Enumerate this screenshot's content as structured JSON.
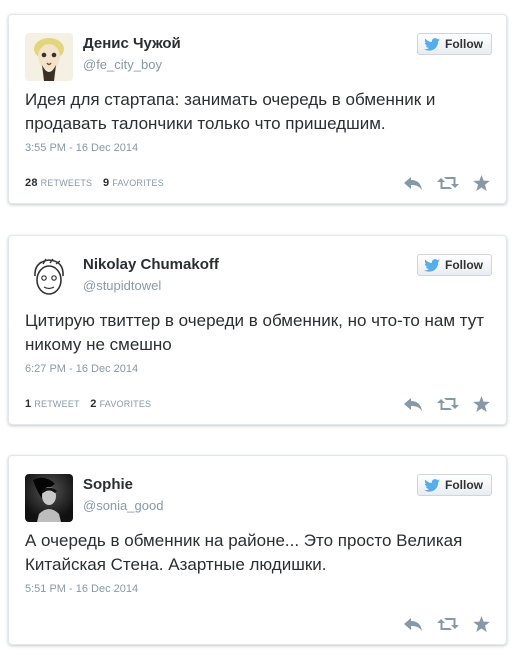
{
  "colors": {
    "twitter_blue": "#55acee",
    "muted": "#8899a6",
    "action_icon": "#8899a6"
  },
  "follow_label": "Follow",
  "tweets": [
    {
      "name": "Денис Чужой",
      "handle": "@fe_city_boy",
      "text": "Идея для стартапа: занимать очередь в обменник и продавать талончики только что пришедшим.",
      "time": "3:55 PM - 16 Dec 2014",
      "retweets_count": "28",
      "retweets_label": "RETWEETS",
      "favorites_count": "9",
      "favorites_label": "FAVORITES",
      "avatar_icon": "cartoon-face-avatar"
    },
    {
      "name": "Nikolay Chumakoff",
      "handle": "@stupidtowel",
      "text": "Цитирую твиттер в очереди в обменник, но что-то нам тут никому не смешно",
      "time": "6:27 PM - 16 Dec 2014",
      "retweets_count": "1",
      "retweets_label": "RETWEET",
      "favorites_count": "2",
      "favorites_label": "FAVORITES",
      "avatar_icon": "sketch-face-avatar"
    },
    {
      "name": "Sophie",
      "handle": "@sonia_good",
      "text": "А очередь в обменник на районе... Это просто Великая Китайская Стена. Азартные людишки.",
      "time": "5:51 PM - 16 Dec 2014",
      "retweets_count": "",
      "retweets_label": "",
      "favorites_count": "",
      "favorites_label": "",
      "avatar_icon": "photo-avatar"
    }
  ]
}
